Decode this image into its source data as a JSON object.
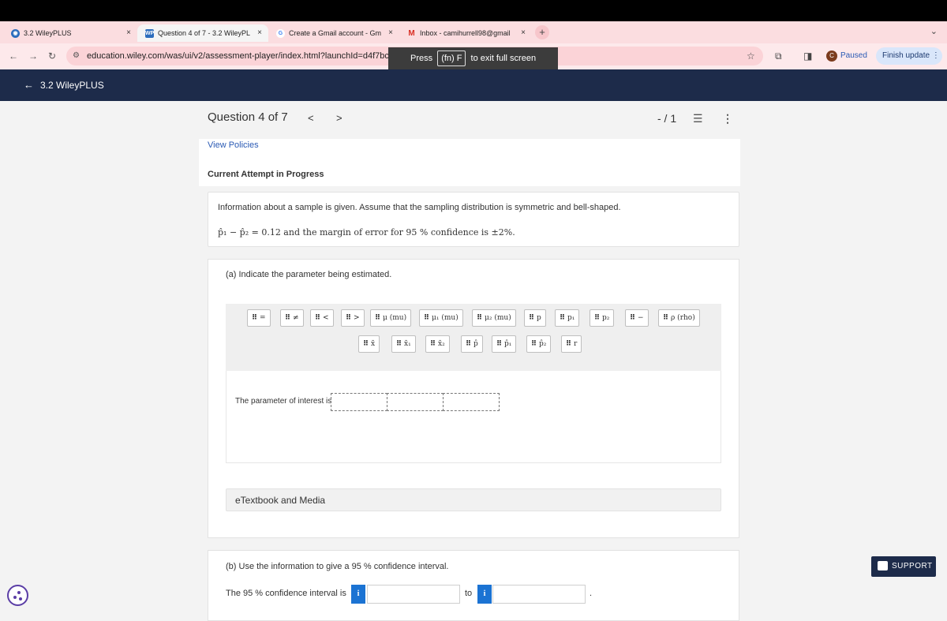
{
  "browser": {
    "tabs": [
      {
        "title": "3.2 WileyPLUS",
        "close": "×"
      },
      {
        "title": "Question 4 of 7 - 3.2 WileyPL",
        "close": "×"
      },
      {
        "title": "Create a Gmail account - Gm",
        "close": "×"
      },
      {
        "title": "Inbox - camihurrell98@gmail",
        "close": "×"
      }
    ],
    "new_tab": "+",
    "url": "education.wiley.com/was/ui/v2/assessment-player/index.html?launchId=d4f7bc63-",
    "fullscreen_notice": {
      "prefix": "Press",
      "key": "(fn) F",
      "suffix": "to exit full screen"
    },
    "profile_initial": "C",
    "profile_status": "Paused",
    "finish_update": "Finish update ⋮"
  },
  "app": {
    "back_label": "3.2 WileyPLUS"
  },
  "question": {
    "title": "Question 4 of 7",
    "prev": "<",
    "next": ">",
    "score": "- / 1",
    "view_policies": "View Policies",
    "attempt_status": "Current Attempt in Progress",
    "info_text": "Information about a sample is given. Assume that the sampling distribution is symmetric and bell-shaped.",
    "info_math": "p̂₁ − p̂₂ = 0.12 and the margin of error for 95 % confidence is ±2%."
  },
  "partA": {
    "title": "(a) Indicate the parameter being estimated.",
    "tokens_row1": [
      "=",
      "≠",
      "<",
      ">",
      "μ (mu)",
      "μ₁ (mu)",
      "μ₂ (mu)",
      "p",
      "p₁",
      "p₂",
      "−",
      "ρ (rho)"
    ],
    "tokens_row2": [
      "x̄",
      "x̄₁",
      "x̄₂",
      "p̂",
      "p̂₁",
      "p̂₂",
      "r"
    ],
    "parameter_label": "The parameter of interest is",
    "etextbook": "eTextbook and Media"
  },
  "partB": {
    "title": "(b) Use the information to give a 95 % confidence interval.",
    "ci_label": "The 95 % confidence interval is",
    "info_icon": "i",
    "to": "to",
    "period": "."
  },
  "support": "SUPPORT",
  "icons": [
    "wiley-icon",
    "gmail-icon",
    "google-icon",
    "back-icon",
    "forward-icon",
    "reload-icon",
    "site-settings-icon",
    "star-icon",
    "extensions-icon",
    "sidebar-icon",
    "list-icon",
    "more-icon",
    "drag-grip-icon",
    "info-icon",
    "support-icon",
    "cookie-icon"
  ]
}
